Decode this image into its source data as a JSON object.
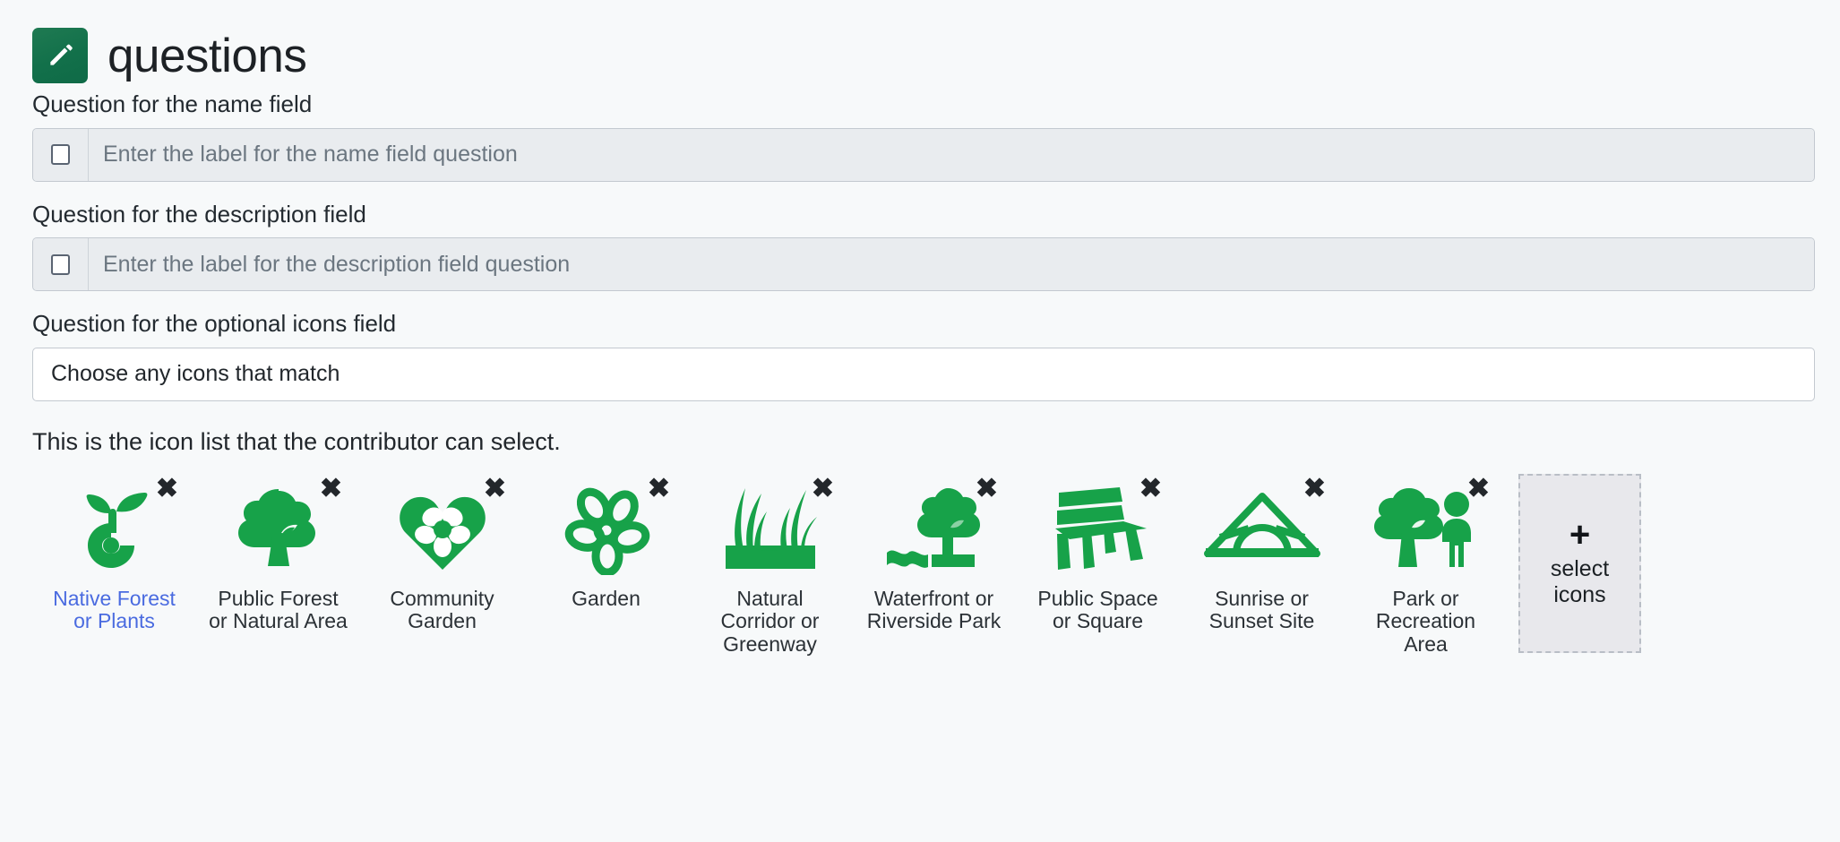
{
  "header": {
    "icon": "pencil-icon",
    "title": "questions",
    "badge_color": "#16774d"
  },
  "fields": [
    {
      "label": "Question for the name field",
      "placeholder": "Enter the label for the name field question",
      "value": "",
      "checkbox_checked": false,
      "disabled": true
    },
    {
      "label": "Question for the description field",
      "placeholder": "Enter the label for the description field question",
      "value": "",
      "checkbox_checked": false,
      "disabled": true
    }
  ],
  "icons_field": {
    "label": "Question for the optional icons field",
    "value": "Choose any icons that match",
    "placeholder": "Choose any icons that match"
  },
  "icon_list": {
    "help_text": "This is the icon list that the contributor can select.",
    "remove_glyph": "✖",
    "icon_color": "#17a249",
    "items": [
      {
        "label": "Native Forest or Plants",
        "icon": "seedling-sprout-icon",
        "is_link": true
      },
      {
        "label": "Public Forest or Natural Area",
        "icon": "tree-icon",
        "is_link": false
      },
      {
        "label": "Community Garden",
        "icon": "heart-flower-icon",
        "is_link": false
      },
      {
        "label": "Garden",
        "icon": "flower-outline-icon",
        "is_link": false
      },
      {
        "label": "Natural Corridor or Greenway",
        "icon": "grass-icon",
        "is_link": false
      },
      {
        "label": "Waterfront or Riverside Park",
        "icon": "tree-water-icon",
        "is_link": false
      },
      {
        "label": "Public Space or Square",
        "icon": "park-bench-icon",
        "is_link": false
      },
      {
        "label": "Sunrise or Sunset Site",
        "icon": "sunrise-icon",
        "is_link": false
      },
      {
        "label": "Park or Recreation Area",
        "icon": "tree-person-icon",
        "is_link": false
      }
    ],
    "add_button": {
      "plus": "+",
      "label_line1": "select",
      "label_line2": "icons"
    }
  }
}
